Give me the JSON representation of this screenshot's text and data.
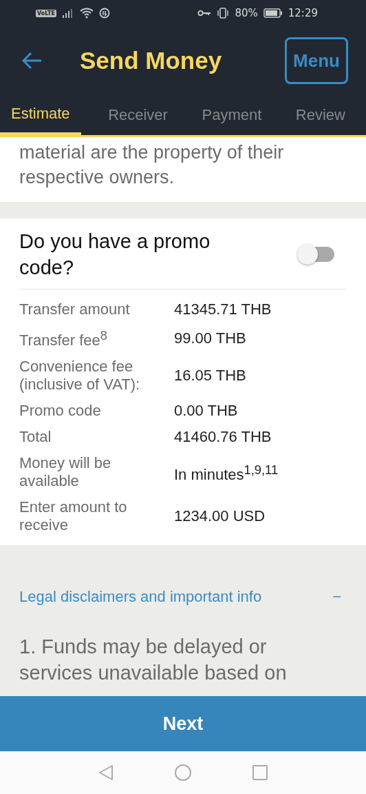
{
  "status_bar": {
    "volte": "VoLTE",
    "battery_percent": "80%",
    "time": "12:29"
  },
  "header": {
    "title": "Send Money",
    "menu_button": "Menu"
  },
  "tabs": [
    {
      "label": "Estimate",
      "selected": true
    },
    {
      "label": "Receiver",
      "selected": false
    },
    {
      "label": "Payment",
      "selected": false
    },
    {
      "label": "Review",
      "selected": false
    }
  ],
  "intro_text": "material are the property of their respective owners.",
  "promo": {
    "question": "Do you have a promo code?",
    "on": false
  },
  "summary": [
    {
      "label": "Transfer amount",
      "value": "41345.71 THB"
    },
    {
      "label": "Transfer fee$^{8}$",
      "value": "99.00 THB"
    },
    {
      "label": "Convenience fee (inclusive of VAT):",
      "value": "16.05 THB"
    },
    {
      "label": "Promo code",
      "value": "0.00 THB"
    },
    {
      "label": "Total",
      "value": "41460.76 THB"
    },
    {
      "label": "Money will be available",
      "value": "In minutes$^{1,9,11}$"
    },
    {
      "label": "Enter amount to receive",
      "value": "1234.00 USD"
    }
  ],
  "legal": {
    "title": "Legal disclaimers and important info",
    "toggle": "−",
    "expanded": true,
    "text": "1. Funds may be delayed or services unavailable based on"
  },
  "next_button": "Next"
}
